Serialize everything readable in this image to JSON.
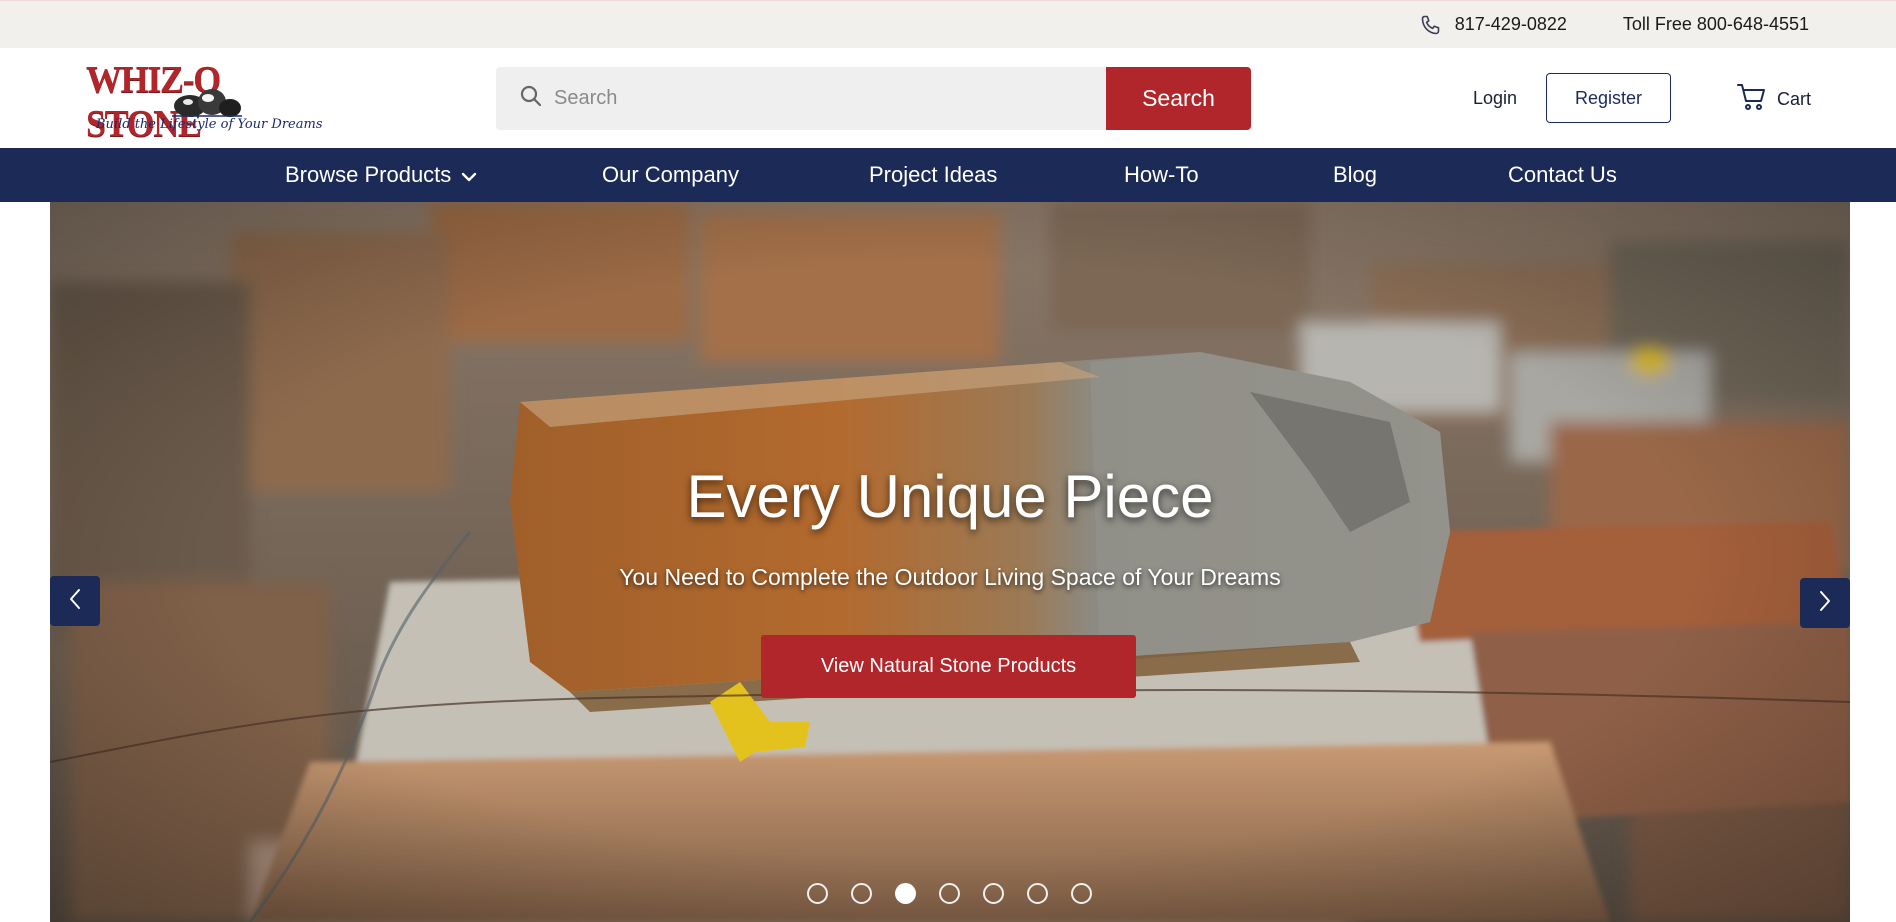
{
  "topbar": {
    "phone": "817-429-0822",
    "toll_free": "Toll Free 800-648-4551",
    "phone_icon": "phone-icon"
  },
  "header": {
    "logo_text": "WHIZ-Q STONE",
    "logo_tagline": "Build the Lifestyle of Your Dreams",
    "search_placeholder": "Search",
    "search_button": "Search",
    "login": "Login",
    "register": "Register",
    "cart": "Cart"
  },
  "nav": {
    "items": [
      {
        "label": "Browse Products",
        "dropdown": true
      },
      {
        "label": "Our Company"
      },
      {
        "label": "Project Ideas"
      },
      {
        "label": "How-To"
      },
      {
        "label": "Blog"
      },
      {
        "label": "Contact Us"
      }
    ]
  },
  "hero": {
    "headline": "Every Unique Piece",
    "subline": "You Need to Complete the Outdoor Living Space of Your Dreams",
    "cta": "View Natural Stone Products",
    "slide_count": 7,
    "active_slide": 3
  },
  "colors": {
    "brand_red": "#b1262b",
    "navy": "#1b2a56",
    "topbar_bg": "#f2f0ed"
  }
}
